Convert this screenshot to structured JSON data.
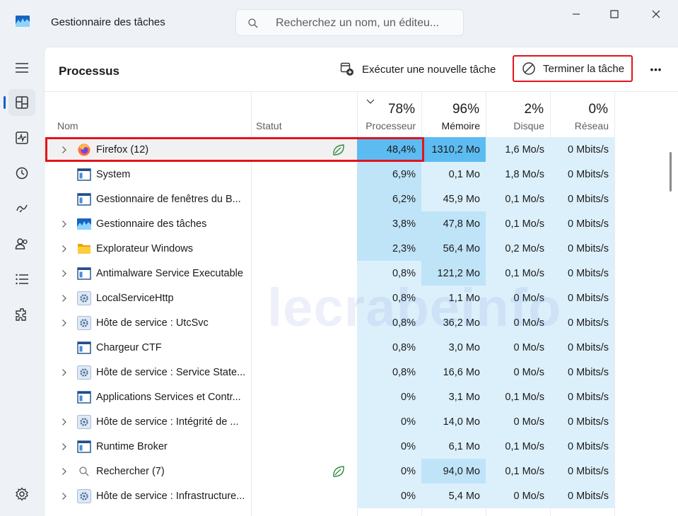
{
  "window": {
    "title": "Gestionnaire des tâches",
    "search_placeholder": "Recherchez un nom, un éditeu...",
    "controls": [
      "minimize",
      "maximize",
      "close"
    ]
  },
  "sidebar": {
    "items": [
      {
        "icon": "hamburger-icon"
      },
      {
        "icon": "processes-icon",
        "active": true
      },
      {
        "icon": "performance-icon"
      },
      {
        "icon": "app-history-icon"
      },
      {
        "icon": "startup-apps-icon"
      },
      {
        "icon": "users-icon"
      },
      {
        "icon": "details-icon"
      },
      {
        "icon": "services-icon"
      }
    ],
    "bottom_icon": "settings-icon"
  },
  "toolbar": {
    "page_title": "Processus",
    "run_task_label": "Exécuter une nouvelle tâche",
    "end_task_label": "Terminer la tâche",
    "more_label": "•••"
  },
  "columns": {
    "name": "Nom",
    "status": "Statut",
    "cpu": {
      "label": "Processeur",
      "total": "78%"
    },
    "memory": {
      "label": "Mémoire",
      "total": "96%"
    },
    "disk": {
      "label": "Disque",
      "total": "2%"
    },
    "network": {
      "label": "Réseau",
      "total": "0%"
    }
  },
  "rows": [
    {
      "name": "Firefox (12)",
      "expandable": true,
      "icon": "firefox-icon",
      "efficiency": true,
      "cpu": "48,4%",
      "memory": "1310,2 Mo",
      "disk": "1,6 Mo/s",
      "network": "0 Mbits/s",
      "cpu_level": 3,
      "mem_level": 3,
      "selected": true
    },
    {
      "name": "System",
      "expandable": false,
      "icon": "window-app-icon",
      "efficiency": false,
      "cpu": "6,9%",
      "memory": "0,1 Mo",
      "disk": "1,8 Mo/s",
      "network": "0 Mbits/s",
      "cpu_level": 2,
      "mem_level": 1
    },
    {
      "name": "Gestionnaire de fenêtres du B...",
      "expandable": false,
      "icon": "window-app-icon",
      "efficiency": false,
      "cpu": "6,2%",
      "memory": "45,9 Mo",
      "disk": "0,1 Mo/s",
      "network": "0 Mbits/s",
      "cpu_level": 2,
      "mem_level": 1
    },
    {
      "name": "Gestionnaire des tâches",
      "expandable": true,
      "icon": "task-manager-icon",
      "efficiency": false,
      "cpu": "3,8%",
      "memory": "47,8 Mo",
      "disk": "0,1 Mo/s",
      "network": "0 Mbits/s",
      "cpu_level": 2,
      "mem_level": 2
    },
    {
      "name": "Explorateur Windows",
      "expandable": true,
      "icon": "folder-icon",
      "efficiency": false,
      "cpu": "2,3%",
      "memory": "56,4 Mo",
      "disk": "0,2 Mo/s",
      "network": "0 Mbits/s",
      "cpu_level": 2,
      "mem_level": 2
    },
    {
      "name": "Antimalware Service Executable",
      "expandable": true,
      "icon": "window-app-icon",
      "efficiency": false,
      "cpu": "0,8%",
      "memory": "121,2 Mo",
      "disk": "0,1 Mo/s",
      "network": "0 Mbits/s",
      "cpu_level": 1,
      "mem_level": 2
    },
    {
      "name": "LocalServiceHttp",
      "expandable": true,
      "icon": "service-gear-icon",
      "efficiency": false,
      "cpu": "0,8%",
      "memory": "1,1 Mo",
      "disk": "0 Mo/s",
      "network": "0 Mbits/s",
      "cpu_level": 1,
      "mem_level": 1
    },
    {
      "name": "Hôte de service : UtcSvc",
      "expandable": true,
      "icon": "service-gear-icon",
      "efficiency": false,
      "cpu": "0,8%",
      "memory": "36,2 Mo",
      "disk": "0 Mo/s",
      "network": "0 Mbits/s",
      "cpu_level": 1,
      "mem_level": 1
    },
    {
      "name": "Chargeur CTF",
      "expandable": false,
      "icon": "window-app-icon",
      "efficiency": false,
      "cpu": "0,8%",
      "memory": "3,0 Mo",
      "disk": "0 Mo/s",
      "network": "0 Mbits/s",
      "cpu_level": 1,
      "mem_level": 1
    },
    {
      "name": "Hôte de service : Service State...",
      "expandable": true,
      "icon": "service-gear-icon",
      "efficiency": false,
      "cpu": "0,8%",
      "memory": "16,6 Mo",
      "disk": "0 Mo/s",
      "network": "0 Mbits/s",
      "cpu_level": 1,
      "mem_level": 1
    },
    {
      "name": "Applications Services et Contr...",
      "expandable": false,
      "icon": "window-app-icon",
      "efficiency": false,
      "cpu": "0%",
      "memory": "3,1 Mo",
      "disk": "0,1 Mo/s",
      "network": "0 Mbits/s",
      "cpu_level": 1,
      "mem_level": 1
    },
    {
      "name": "Hôte de service : Intégrité de ...",
      "expandable": true,
      "icon": "service-gear-icon",
      "efficiency": false,
      "cpu": "0%",
      "memory": "14,0 Mo",
      "disk": "0 Mo/s",
      "network": "0 Mbits/s",
      "cpu_level": 1,
      "mem_level": 1
    },
    {
      "name": "Runtime Broker",
      "expandable": true,
      "icon": "window-app-icon",
      "efficiency": false,
      "cpu": "0%",
      "memory": "6,1 Mo",
      "disk": "0,1 Mo/s",
      "network": "0 Mbits/s",
      "cpu_level": 1,
      "mem_level": 1
    },
    {
      "name": "Rechercher (7)",
      "expandable": true,
      "icon": "search-app-icon",
      "efficiency": true,
      "cpu": "0%",
      "memory": "94,0 Mo",
      "disk": "0,1 Mo/s",
      "network": "0 Mbits/s",
      "cpu_level": 1,
      "mem_level": 2
    },
    {
      "name": "Hôte de service : Infrastructure...",
      "expandable": true,
      "icon": "service-gear-icon",
      "efficiency": false,
      "cpu": "0%",
      "memory": "5,4 Mo",
      "disk": "0 Mo/s",
      "network": "0 Mbits/s",
      "cpu_level": 1,
      "mem_level": 1
    }
  ],
  "colors": {
    "heat_1": "#dcf0fb",
    "heat_2": "#bfe4f8",
    "heat_3": "#5cbbf0",
    "highlight": "#e1141b",
    "accent": "#0a5fc8"
  },
  "watermark": "lecrabeinfo"
}
